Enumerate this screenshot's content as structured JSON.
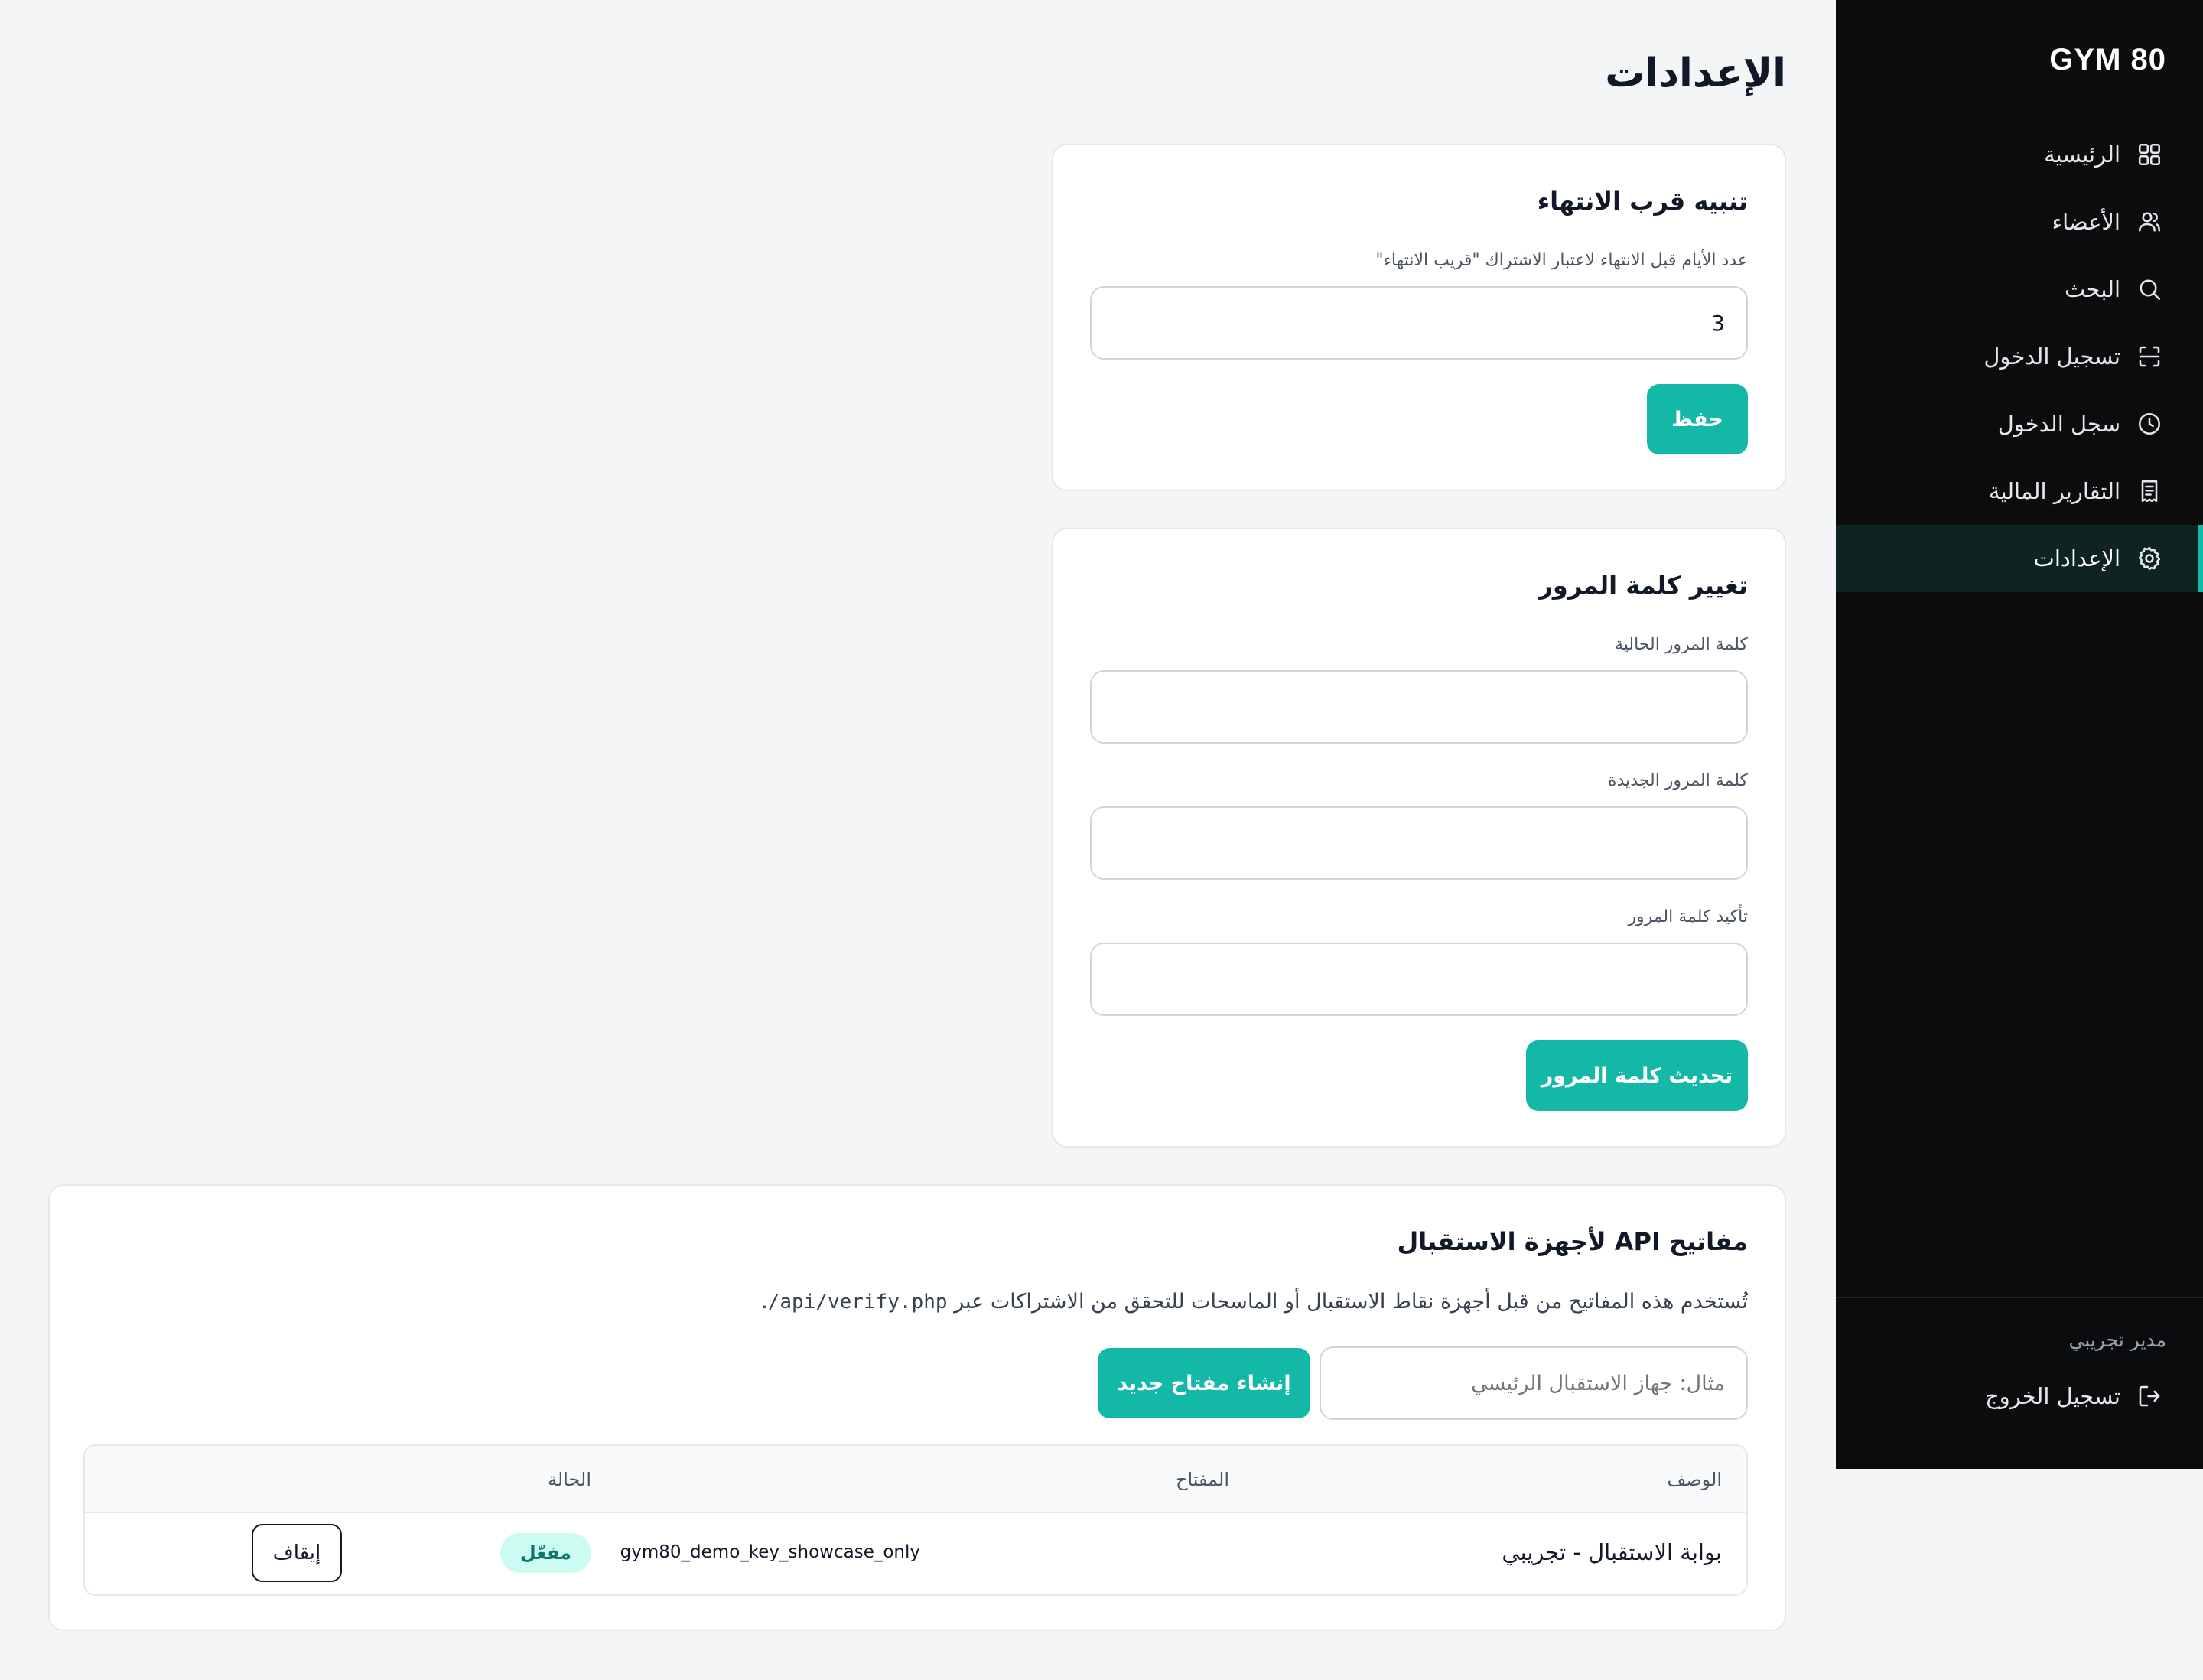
{
  "app": {
    "brand": "GYM 80"
  },
  "page": {
    "title": "الإعدادات"
  },
  "sidebar": {
    "items": [
      {
        "label": "الرئيسية",
        "icon": "dashboard-icon"
      },
      {
        "label": "الأعضاء",
        "icon": "users-icon"
      },
      {
        "label": "البحث",
        "icon": "search-icon"
      },
      {
        "label": "تسجيل الدخول",
        "icon": "scan-icon"
      },
      {
        "label": "سجل الدخول",
        "icon": "clock-icon"
      },
      {
        "label": "التقارير المالية",
        "icon": "receipt-icon"
      },
      {
        "label": "الإعدادات",
        "icon": "gear-icon",
        "active": true
      }
    ],
    "user_name": "مدير تجريبي",
    "logout_label": "تسجيل الخروج"
  },
  "expiry_alert": {
    "title": "تنبيه قرب الانتهاء",
    "days_label": "عدد الأيام قبل الانتهاء لاعتبار الاشتراك \"قريب الانتهاء\"",
    "days_value": "3",
    "save_label": "حفظ"
  },
  "password": {
    "title": "تغيير كلمة المرور",
    "current_label": "كلمة المرور الحالية",
    "new_label": "كلمة المرور الجديدة",
    "confirm_label": "تأكيد كلمة المرور",
    "submit_label": "تحديث كلمة المرور"
  },
  "api_keys": {
    "title": "مفاتيح API لأجهزة الاستقبال",
    "description": "تُستخدم هذه المفاتيح من قبل أجهزة نقاط الاستقبال أو الماسحات للتحقق من الاشتراكات عبر",
    "endpoint": "/api/verify.php",
    "description_end": ".",
    "input_placeholder": "مثال: جهاز الاستقبال الرئيسي",
    "create_label": "إنشاء مفتاح جديد",
    "columns": {
      "description": "الوصف",
      "key": "المفتاح",
      "status": "الحالة"
    },
    "rows": [
      {
        "description": "بوابة الاستقبال - تجريبي",
        "key": "gym80_demo_key_showcase_only",
        "status": "مفعّل",
        "action": "إيقاف"
      }
    ]
  },
  "colors": {
    "accent": "#14b8a6",
    "sidebar_bg": "#0b0c0e",
    "page_bg": "#f4f5f7",
    "badge_bg": "#ccfbf1",
    "badge_text": "#0f766e"
  }
}
